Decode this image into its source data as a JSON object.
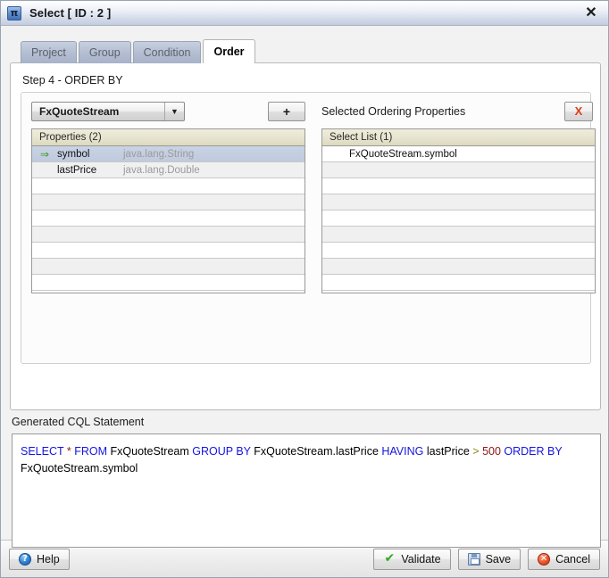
{
  "window": {
    "title": "Select [ ID : 2 ]",
    "app_icon": "pi-icon",
    "close_icon": "close-icon",
    "close_label": "✕"
  },
  "tabs": [
    {
      "label": "Project",
      "active": false
    },
    {
      "label": "Group",
      "active": false
    },
    {
      "label": "Condition",
      "active": false
    },
    {
      "label": "Order",
      "active": true
    }
  ],
  "panel": {
    "step_label": "Step 4 - ORDER BY",
    "source_combo": {
      "value": "FxQuoteStream",
      "arrow_icon": "chevron-down-icon",
      "arrow_glyph": "▼"
    },
    "add_button": {
      "label": "+",
      "icon": "plus-icon"
    },
    "right_title": "Selected Ordering Properties",
    "remove_button": {
      "label": "X",
      "icon": "red-x-icon"
    },
    "left_list": {
      "header": "Properties (2)",
      "empty_row_count": 7,
      "rows": [
        {
          "selected": true,
          "marker": "⇒",
          "name": "symbol",
          "type": "java.lang.String"
        },
        {
          "selected": false,
          "marker": "",
          "name": "lastPrice",
          "type": "java.lang.Double"
        }
      ]
    },
    "right_list": {
      "header": "Select List (1)",
      "empty_row_count": 8,
      "rows": [
        {
          "text": "FxQuoteStream.symbol"
        }
      ]
    }
  },
  "cql": {
    "label": "Generated CQL Statement",
    "tokens": [
      {
        "text": "SELECT",
        "kind": "kw"
      },
      {
        "text": " ",
        "kind": "plain"
      },
      {
        "text": "*",
        "kind": "lit"
      },
      {
        "text": " ",
        "kind": "plain"
      },
      {
        "text": "FROM",
        "kind": "kw"
      },
      {
        "text": " FxQuoteStream  ",
        "kind": "plain"
      },
      {
        "text": "GROUP BY",
        "kind": "kw"
      },
      {
        "text": " FxQuoteStream.lastPrice ",
        "kind": "plain"
      },
      {
        "text": "HAVING",
        "kind": "kw"
      },
      {
        "text": " lastPrice ",
        "kind": "plain"
      },
      {
        "text": ">",
        "kind": "op"
      },
      {
        "text": " ",
        "kind": "plain"
      },
      {
        "text": "500",
        "kind": "lit"
      },
      {
        "text": " ",
        "kind": "plain"
      },
      {
        "text": "ORDER BY",
        "kind": "kw"
      },
      {
        "text": " FxQuoteStream.symbol",
        "kind": "plain"
      }
    ],
    "plain_text": "SELECT * FROM FxQuoteStream  GROUP BY FxQuoteStream.lastPrice HAVING lastPrice > 500 ORDER BY FxQuoteStream.symbol"
  },
  "footer": {
    "help": {
      "label": "Help",
      "icon": "help-icon",
      "glyph": "?"
    },
    "validate": {
      "label": "Validate",
      "icon": "check-icon",
      "glyph": "✔"
    },
    "save": {
      "label": "Save",
      "icon": "floppy-icon",
      "glyph": ""
    },
    "cancel": {
      "label": "Cancel",
      "icon": "cancel-icon",
      "glyph": "✕"
    }
  },
  "colors": {
    "keyword": "#1414e0",
    "literal": "#8b1616",
    "operator": "#8a8a11",
    "selection": "#c9d3e4",
    "list_header": "#e6e3cd",
    "accent_red": "#e03c14",
    "accent_green": "#3f9b23"
  }
}
